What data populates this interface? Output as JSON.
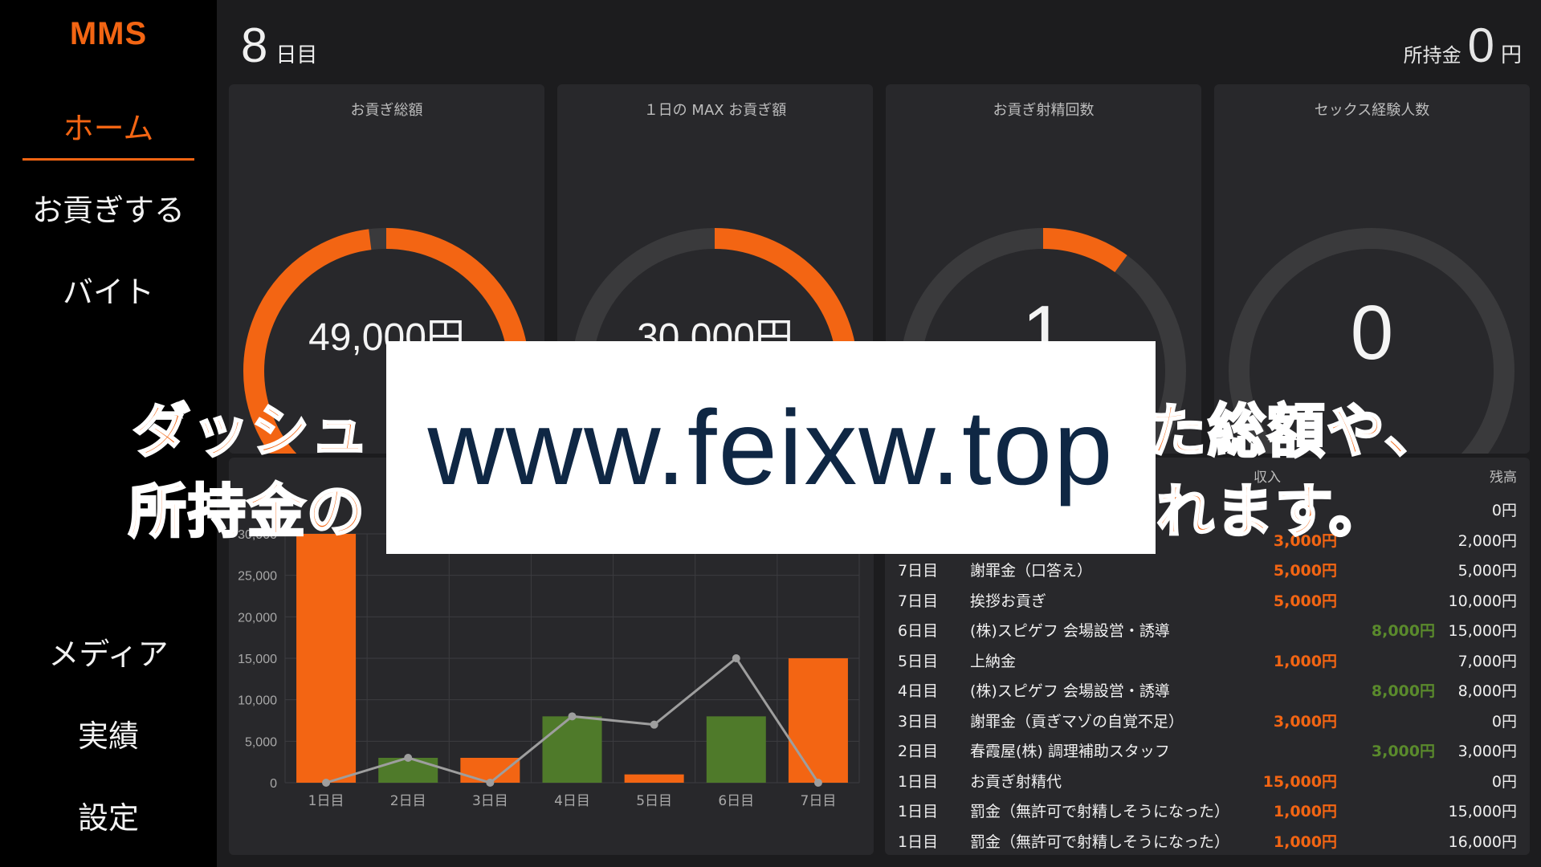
{
  "app": {
    "logo": "MMS"
  },
  "sidebar": {
    "items": [
      {
        "label": "ホーム",
        "active": true
      },
      {
        "label": "お貢ぎする",
        "active": false
      },
      {
        "label": "バイト",
        "active": false
      },
      {
        "label": "メディア",
        "active": false
      },
      {
        "label": "実績",
        "active": false
      },
      {
        "label": "設定",
        "active": false
      }
    ]
  },
  "header": {
    "day_number": "8",
    "day_suffix": "日目",
    "wallet_label": "所持金",
    "wallet_value": "0",
    "wallet_unit": "円"
  },
  "stats": [
    {
      "title": "お貢ぎ総額",
      "value": "49,000円",
      "progress": 0.98
    },
    {
      "title": "１日の MAX お貢ぎ額",
      "value": "30,000円",
      "progress": 0.5
    },
    {
      "title": "お貢ぎ射精回数",
      "value": "1",
      "progress": 0.1
    },
    {
      "title": "セックス経験人数",
      "value": "0",
      "progress": 0.0
    }
  ],
  "colors": {
    "accent": "#f36513",
    "income": "#4f7a2a",
    "track": "#3a3a3c",
    "line": "#9e9e9e"
  },
  "chart_data": {
    "type": "bar",
    "categories": [
      "1日目",
      "2日目",
      "3日目",
      "4日目",
      "5日目",
      "6日目",
      "7日目"
    ],
    "ylim": [
      0,
      30000
    ],
    "yticks": [
      "0",
      "5,000",
      "10,000",
      "15,000",
      "20,000",
      "25,000",
      "30,000"
    ],
    "bars": [
      {
        "value": 30000,
        "kind": "expense"
      },
      {
        "value": 3000,
        "kind": "income"
      },
      {
        "value": 3000,
        "kind": "expense"
      },
      {
        "value": 8000,
        "kind": "income"
      },
      {
        "value": 1000,
        "kind": "expense"
      },
      {
        "value": 8000,
        "kind": "income"
      },
      {
        "value": 15000,
        "kind": "expense"
      }
    ],
    "line": {
      "values": [
        0,
        3000,
        0,
        8000,
        7000,
        15000,
        0
      ]
    }
  },
  "ledger": {
    "headers": {
      "income": "収入",
      "balance": "残高"
    },
    "rows": [
      {
        "day": "",
        "desc": "",
        "expense": "",
        "income": "",
        "balance": "0円"
      },
      {
        "day": "",
        "desc": "",
        "expense": "3,000円",
        "income": "",
        "balance": "2,000円"
      },
      {
        "day": "7日目",
        "desc": "謝罪金（口答え）",
        "expense": "5,000円",
        "income": "",
        "balance": "5,000円"
      },
      {
        "day": "7日目",
        "desc": "挨拶お貢ぎ",
        "expense": "5,000円",
        "income": "",
        "balance": "10,000円"
      },
      {
        "day": "6日目",
        "desc": "(株)スピゲフ 会場設営・誘導",
        "expense": "",
        "income": "8,000円",
        "balance": "15,000円"
      },
      {
        "day": "5日目",
        "desc": "上納金",
        "expense": "1,000円",
        "income": "",
        "balance": "7,000円"
      },
      {
        "day": "4日目",
        "desc": "(株)スピゲフ 会場設営・誘導",
        "expense": "",
        "income": "8,000円",
        "balance": "8,000円"
      },
      {
        "day": "3日目",
        "desc": "謝罪金（貢ぎマゾの自覚不足）",
        "expense": "3,000円",
        "income": "",
        "balance": "0円"
      },
      {
        "day": "2日目",
        "desc": "春霞屋(株) 調理補助スタッフ",
        "expense": "",
        "income": "3,000円",
        "balance": "3,000円"
      },
      {
        "day": "1日目",
        "desc": "お貢ぎ射精代",
        "expense": "15,000円",
        "income": "",
        "balance": "0円"
      },
      {
        "day": "1日目",
        "desc": "罰金（無許可で射精しそうになった）",
        "expense": "1,000円",
        "income": "",
        "balance": "15,000円"
      },
      {
        "day": "1日目",
        "desc": "罰金（無許可で射精しそうになった）",
        "expense": "1,000円",
        "income": "",
        "balance": "16,000円"
      }
    ]
  },
  "overlay": {
    "line1": "ダッシュ",
    "line1_tail": "た総額や、",
    "line2": "所持金の",
    "line2_tail": "れます。",
    "watermark": "www.feixw.top"
  }
}
